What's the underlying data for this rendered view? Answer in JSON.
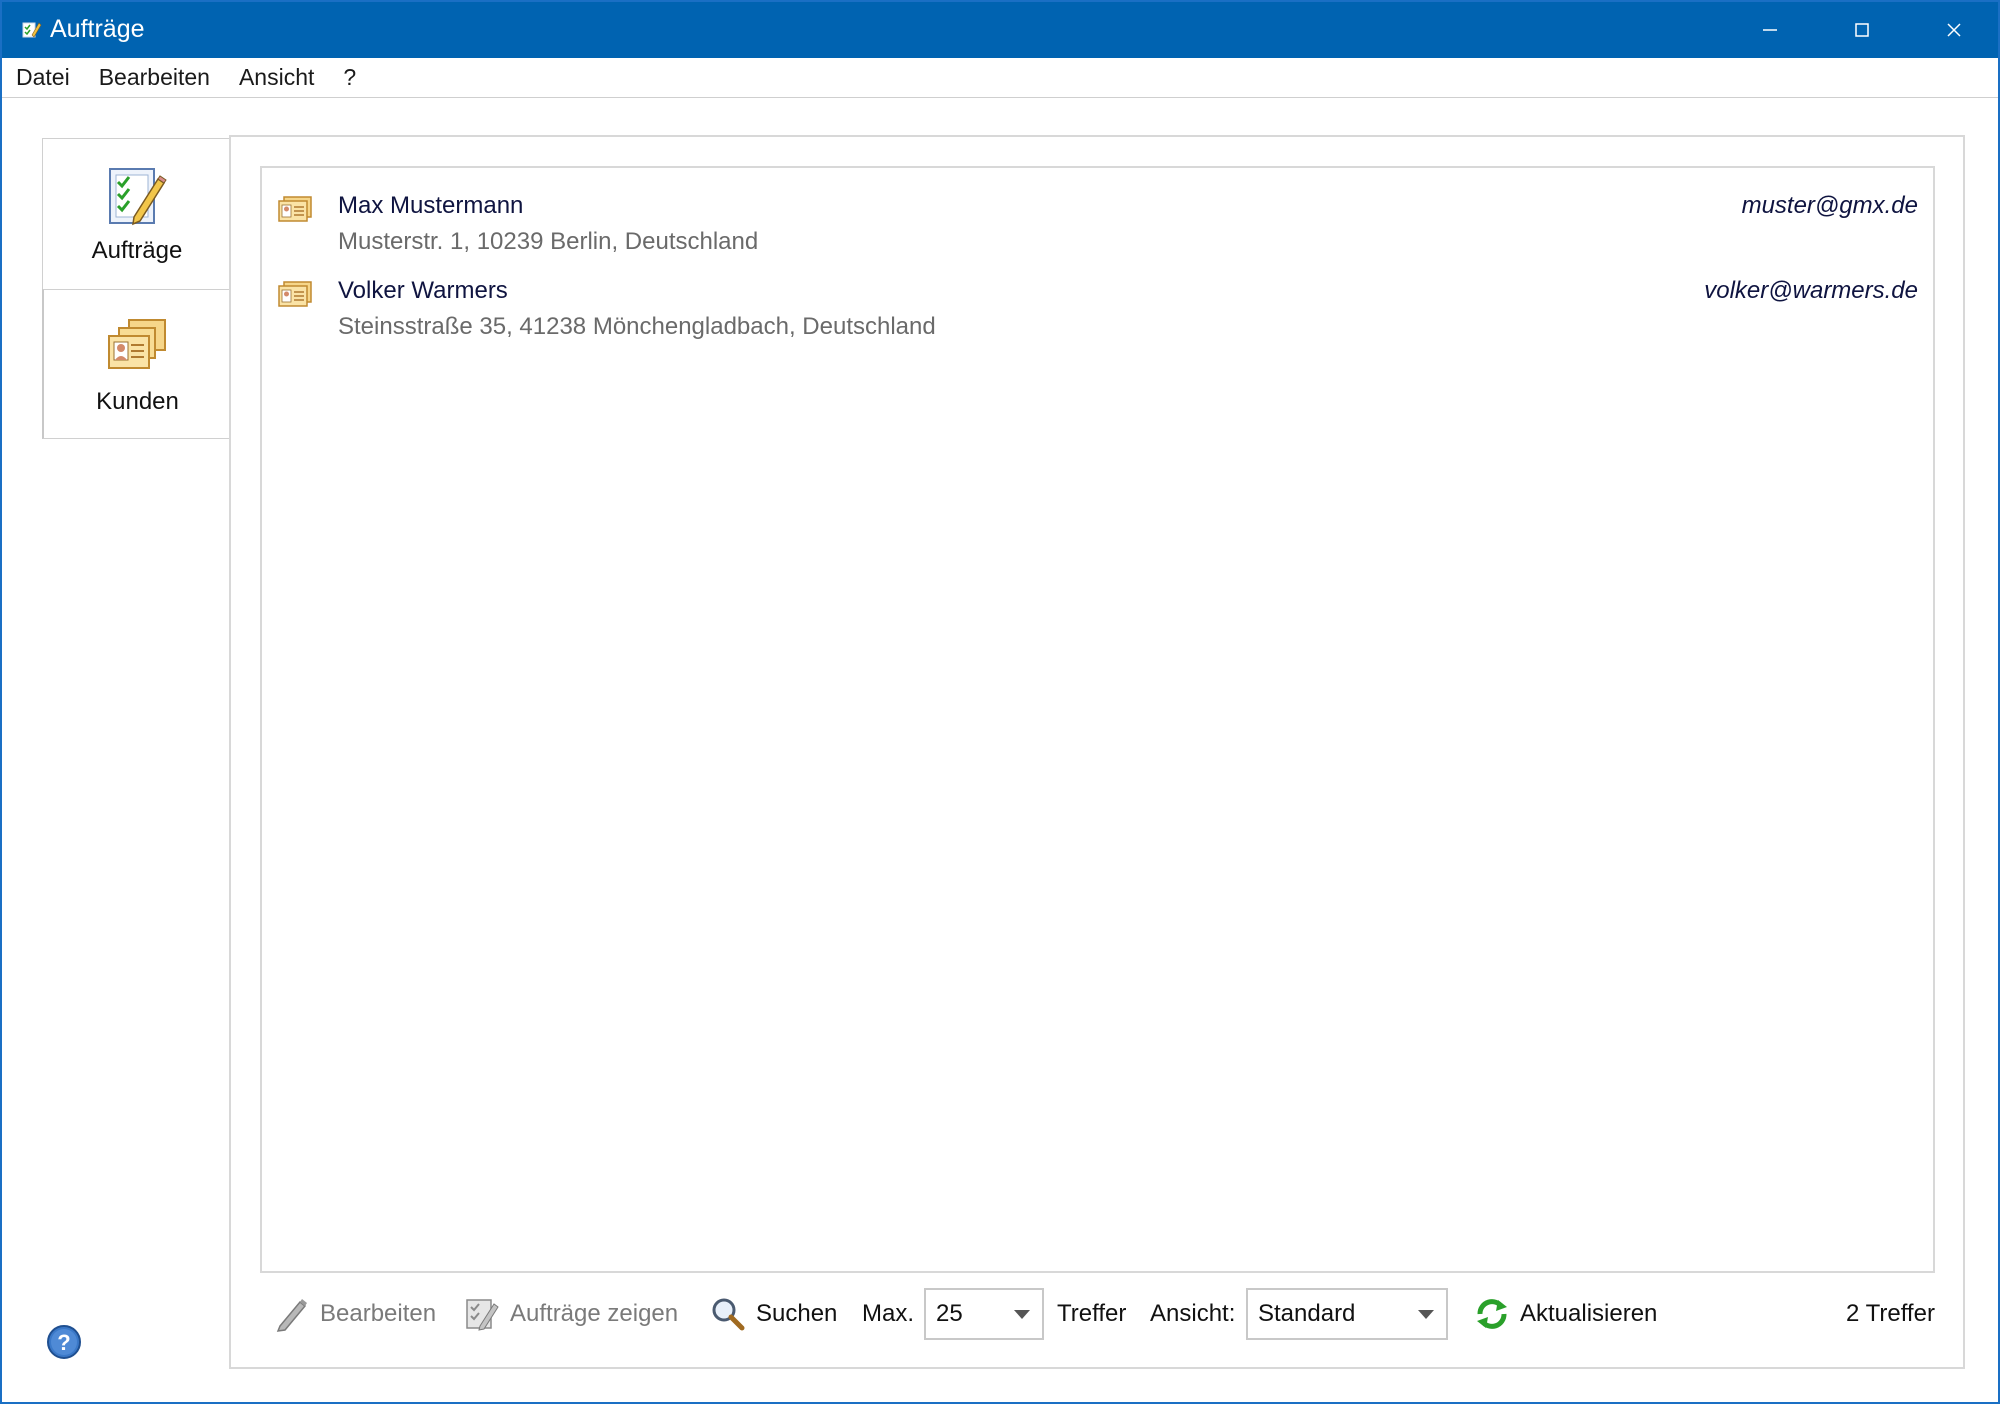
{
  "window": {
    "title": "Aufträge",
    "controls": {
      "minimize": "minimize-icon",
      "maximize": "maximize-icon",
      "close": "close-icon"
    }
  },
  "menu": [
    "Datei",
    "Bearbeiten",
    "Ansicht",
    "?"
  ],
  "sidebar": {
    "tabs": [
      {
        "label": "Aufträge",
        "icon": "checklist-pencil-icon"
      },
      {
        "label": "Kunden",
        "icon": "contact-cards-icon",
        "selected": true
      }
    ]
  },
  "customers": [
    {
      "name": "Max Mustermann",
      "address": "Musterstr. 1, 10239 Berlin, Deutschland",
      "email": "muster@gmx.de",
      "icon": "contact-card-icon"
    },
    {
      "name": "Volker Warmers",
      "address": "Steinsstraße 35, 41238 Mönchengladbach, Deutschland",
      "email": "volker@warmers.de",
      "icon": "contact-card-icon"
    }
  ],
  "toolbar": {
    "edit_label": "Bearbeiten",
    "show_orders_label": "Aufträge zeigen",
    "search_label": "Suchen",
    "max_label": "Max.",
    "max_value": "25",
    "hits_label": "Treffer",
    "view_label": "Ansicht:",
    "view_value": "Standard",
    "refresh_label": "Aktualisieren",
    "result_count": "2 Treffer"
  },
  "colors": {
    "titlebar": "#0063b1",
    "name_text": "#0f1440",
    "address_text": "#6a6a6a"
  }
}
